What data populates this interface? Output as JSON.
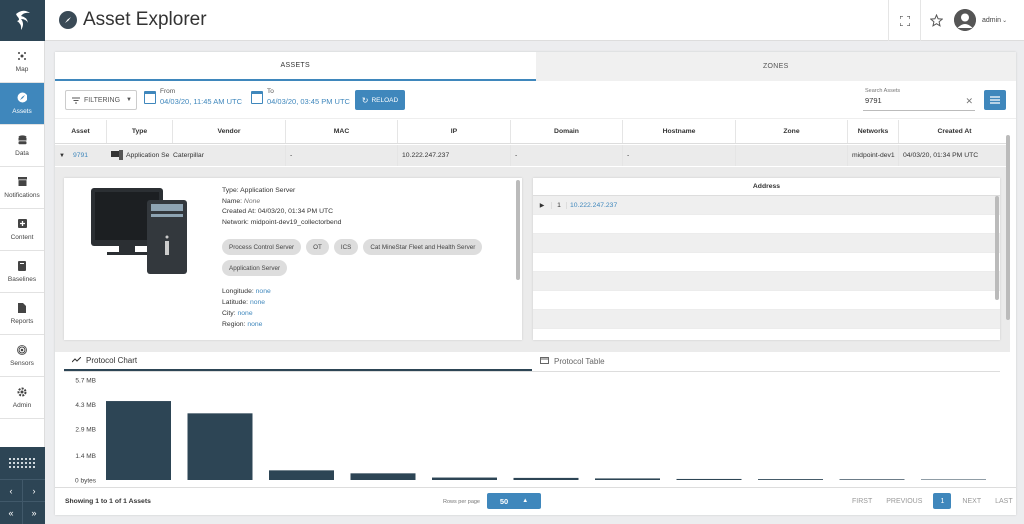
{
  "header": {
    "title": "Asset Explorer",
    "user": "admin"
  },
  "sidebar": {
    "items": [
      {
        "label": "Map",
        "icon": "map-icon"
      },
      {
        "label": "Assets",
        "icon": "compass-icon"
      },
      {
        "label": "Data",
        "icon": "database-icon"
      },
      {
        "label": "Notifications",
        "icon": "inbox-icon"
      },
      {
        "label": "Content",
        "icon": "plus-box-icon"
      },
      {
        "label": "Baselines",
        "icon": "book-icon"
      },
      {
        "label": "Reports",
        "icon": "document-icon"
      },
      {
        "label": "Sensors",
        "icon": "signal-icon"
      },
      {
        "label": "Admin",
        "icon": "gear-icon"
      }
    ]
  },
  "tabs": {
    "assets": "ASSETS",
    "zones": "ZONES"
  },
  "toolbar": {
    "filter_label": "FILTERING",
    "from_label": "From",
    "from_value": "04/03/20, 11:45 AM UTC",
    "to_label": "To",
    "to_value": "04/03/20, 03:45 PM UTC",
    "reload_label": "RELOAD",
    "search_label": "Search Assets",
    "search_value": "9791"
  },
  "table": {
    "columns": [
      "Asset",
      "Type",
      "Vendor",
      "MAC",
      "IP",
      "Domain",
      "Hostname",
      "Zone",
      "Networks",
      "Created At"
    ],
    "row": {
      "asset": "9791",
      "type": "Application Se",
      "vendor": "Caterpillar",
      "mac": "-",
      "ip": "10.222.247.237",
      "domain": "-",
      "hostname": "-",
      "zone": "",
      "networks": "midpoint-dev1",
      "created_at": "04/03/20, 01:34 PM UTC"
    }
  },
  "detail": {
    "type_line": "Type: Application Server",
    "name_prefix": "Name: ",
    "name_value": "None",
    "created_line": "Created At: 04/03/20, 01:34 PM UTC",
    "network_line": "Network: midpoint-dev19_collectorbend",
    "tags": [
      "Process Control Server",
      "OT",
      "ICS",
      "Cat MineStar Fleet and Health Server",
      "Application Server"
    ],
    "longitude_label": "Longitude: ",
    "longitude_value": "none",
    "latitude_label": "Latitude: ",
    "latitude_value": "none",
    "city_label": "City: ",
    "city_value": "none",
    "region_label": "Region: ",
    "region_value": "none"
  },
  "address_panel": {
    "header": "Address",
    "row_index": "1",
    "row_value": "10.222.247.237"
  },
  "protocol": {
    "chart_tab": "Protocol Chart",
    "table_tab": "Protocol Table"
  },
  "chart_data": {
    "type": "bar",
    "ylim": [
      0,
      5.7
    ],
    "yticks": [
      "5.7 MB",
      "4.3 MB",
      "2.9 MB",
      "1.4 MB",
      "0 bytes"
    ],
    "ytick_values": [
      5.7,
      4.3,
      2.9,
      1.4,
      0
    ],
    "unit": "MB",
    "values": [
      4.5,
      3.8,
      0.55,
      0.38,
      0.14,
      0.12,
      0.09,
      0.06,
      0.05,
      0.04,
      0.03,
      0.03
    ],
    "color": "#2d4555"
  },
  "footer": {
    "showing": "Showing 1 to 1 of 1 Assets",
    "rows_per_page_label": "Rows per page",
    "rows_per_page": "50",
    "first": "FIRST",
    "previous": "PREVIOUS",
    "current_page": "1",
    "next": "NEXT",
    "last": "LAST"
  },
  "colors": {
    "accent": "#3f87bc",
    "sidebar_dark": "#2d4555"
  }
}
